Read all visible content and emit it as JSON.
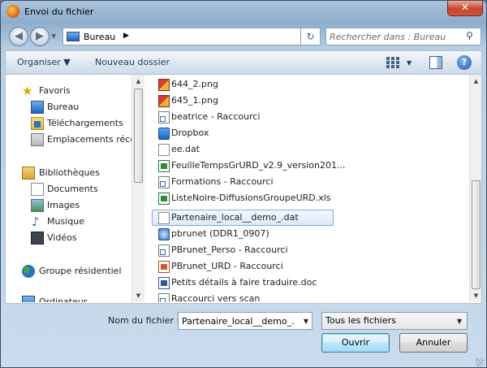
{
  "window": {
    "title": "Envoi du fichier",
    "close_label": "✕"
  },
  "navbar": {
    "back_glyph": "◀",
    "forward_glyph": "▶",
    "breadcrumb": "Bureau",
    "breadcrumb_arrow": "▶",
    "refresh_glyph": "↻",
    "search_placeholder": "Rechercher dans : Bureau"
  },
  "toolbar": {
    "organize_label": "Organiser ▼",
    "new_folder_label": "Nouveau dossier",
    "help_label": "?"
  },
  "sidebar": {
    "items": [
      {
        "label": "Favoris",
        "icon": "star-icon"
      },
      {
        "label": "Bureau",
        "icon": "desktop-icon"
      },
      {
        "label": "Téléchargements",
        "icon": "downloads-icon"
      },
      {
        "label": "Emplacements réce",
        "icon": "recent-places-icon"
      },
      {
        "label": "Bibliothèques",
        "icon": "libraries-icon"
      },
      {
        "label": "Documents",
        "icon": "documents-icon"
      },
      {
        "label": "Images",
        "icon": "images-icon"
      },
      {
        "label": "Musique",
        "icon": "music-icon"
      },
      {
        "label": "Vidéos",
        "icon": "videos-icon"
      },
      {
        "label": "Groupe résidentiel",
        "icon": "homegroup-icon"
      },
      {
        "label": "Ordinateur",
        "icon": "computer-icon"
      }
    ]
  },
  "files": [
    {
      "name": "644_2.png",
      "icon": "png-icon"
    },
    {
      "name": "645_1.png",
      "icon": "png-icon"
    },
    {
      "name": "beatrice - Raccourci",
      "icon": "shortcut-icon"
    },
    {
      "name": "Dropbox",
      "icon": "dropbox-icon"
    },
    {
      "name": "ee.dat",
      "icon": "file-icon"
    },
    {
      "name": "FeuilleTempsGrURD_v2.9_version201...",
      "icon": "excel-icon"
    },
    {
      "name": "Formations - Raccourci",
      "icon": "shortcut-icon"
    },
    {
      "name": "ListeNoire-DiffusionsGroupeURD.xls",
      "icon": "excel-icon"
    },
    {
      "name": "Partenaire_local__demo_.dat",
      "icon": "file-icon",
      "selected": true
    },
    {
      "name": "pbrunet (DDR1_0907)",
      "icon": "network-drive-icon"
    },
    {
      "name": "PBrunet_Perso - Raccourci",
      "icon": "shortcut-icon"
    },
    {
      "name": "PBrunet_URD - Raccourci",
      "icon": "shortcut-icon"
    },
    {
      "name": "Petits détails à faire traduire.doc",
      "icon": "word-icon"
    },
    {
      "name": "Raccourci vers scan",
      "icon": "shortcut-icon"
    }
  ],
  "bottom": {
    "filename_label": "Nom du fichier :",
    "filename_value": "Partenaire_local__demo_.dat",
    "filetype_value": "Tous les fichiers",
    "open_label": "Ouvrir",
    "cancel_label": "Annuler"
  }
}
